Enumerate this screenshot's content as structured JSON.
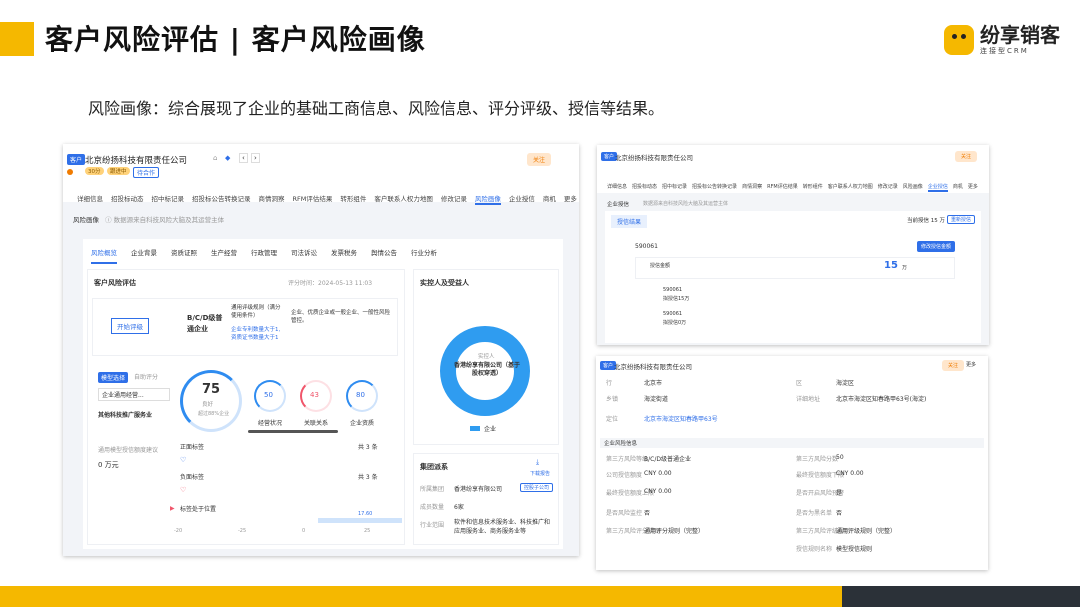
{
  "slide": {
    "title": "客户风险评估 | 客户风险画像",
    "subtitle": "风险画像：综合展现了企业的基础工商信息、风险信息、评分评级、授信等结果。",
    "logo": {
      "name": "纷享销客",
      "tagline": "连接型CRM"
    },
    "colors": {
      "accent": "#f5b800",
      "dark": "#2b3138",
      "brand_blue": "#2f6fe8"
    }
  },
  "main": {
    "header": {
      "tag": "客户",
      "company": "北京纷扬科技有限责任公司",
      "badges": [
        "30分",
        "跟进中"
      ],
      "status": "待合作",
      "follow_button": "关注"
    },
    "nav_tabs": [
      "详细信息",
      "招投标动态",
      "招中标记录",
      "招投标公告转换记录",
      "商情洞察",
      "RFM评估结果",
      "转形组件",
      "客户联系人权力地图",
      "修改记录",
      "风险画像",
      "企业授信",
      "商机",
      "更多"
    ],
    "active_nav": "风险画像",
    "breadcrumb": {
      "title": "风险画像",
      "hint": "数据源来自科技风险大脑及其运营主体"
    },
    "sub_tabs": [
      "风险概览",
      "企业背景",
      "资质证照",
      "生产经营",
      "行政管理",
      "司法诉讼",
      "发票税务",
      "舆情公告",
      "行业分析"
    ],
    "active_sub_tab": "风险概览",
    "risk_eval": {
      "title": "客户风险评估",
      "eval_time": "评分时间：2024-05-13 11:03",
      "start_button": "开始评级",
      "grade": "B/C/D级普通企业",
      "rule_label": "通用评级规则（满分使用条件）",
      "rule_desc": "企业专利数量大于1,资质证书数量大于1",
      "grade_desc": "企业、优质企业或一般企业、一般性风险管控。"
    },
    "model_tabs": [
      "模型选择",
      "自助评分"
    ],
    "model_select": "企业通用经营...",
    "service": "其他科技推广服务业",
    "credit_label": "通用模型授信额度建议",
    "credit_value": "0 万元",
    "score": {
      "value": "75",
      "label": "良好",
      "sub": "超过88%企业"
    },
    "dimensions": [
      {
        "value": "50",
        "label": "经营状况"
      },
      {
        "value": "43",
        "label": "关联关系"
      },
      {
        "value": "80",
        "label": "企业资质"
      }
    ],
    "labels": {
      "positive": "正面标签",
      "positive_count": "共 3 条",
      "negative": "负面标签",
      "negative_count": "共 3 条",
      "position": "标签处于位置",
      "scale": [
        "-20",
        "-25",
        "0",
        "25"
      ],
      "marker": "17.60"
    },
    "shareholder": {
      "title": "实控人及受益人",
      "center_label": "实控人",
      "center_name": "香港纷享有限公司（基于股权穿透）",
      "legend": "企业"
    },
    "group": {
      "title": "集团派系",
      "download": "下载报告",
      "rows": [
        {
          "k": "所属集团",
          "v": "香港纷享有限公司",
          "tag": "控股子公司"
        },
        {
          "k": "成员数量",
          "v": "6家"
        },
        {
          "k": "行业范围",
          "v": "软件和信息技术服务业、科技推广和应用服务业、商务服务业等"
        }
      ]
    }
  },
  "right_top": {
    "company": "北京纷扬科技有限责任公司",
    "nav_tabs": [
      "详细信息",
      "招投标动态",
      "招中标记录",
      "招投标公告转换记录",
      "商情洞察",
      "RFM评估结果",
      "转形组件",
      "客户联系人权力地图",
      "修改记录",
      "风险画像",
      "企业授信",
      "商机",
      "更多"
    ],
    "active_nav": "企业授信",
    "section": "企业授信",
    "hint": "数据源来自科技风险大脑及其运营主体",
    "result_tab": "授信结果",
    "total_label": "当前授信 15 万",
    "refresh_button": "重新授信",
    "id": "590061",
    "modify_button": "修改授信金额",
    "credit": {
      "label": "授信金额",
      "value": "15",
      "unit": "万"
    },
    "history": [
      {
        "id": "590061",
        "desc": "拟授信15万"
      },
      {
        "id": "590061",
        "desc": "拟授信0万"
      }
    ]
  },
  "right_bottom": {
    "company": "北京纷扬科技有限责任公司",
    "follow_button": "关注",
    "more_button": "更多",
    "rows": [
      {
        "k": "行",
        "v": "北京市",
        "k2": "区",
        "v2": "海淀区"
      },
      {
        "k": "乡镇",
        "v": "海淀街道",
        "k2": "详细地址",
        "v2": "北京市海淀区知春路甲63号(海淀)"
      },
      {
        "k": "定位",
        "v": "北京市海淀区知春路甲63号"
      }
    ],
    "section": "企业风险信息",
    "risk_rows": [
      {
        "k": "第三方风险等级",
        "v": "B/C/D级普通企业",
        "k2": "第三方风险分数",
        "v2": "50"
      },
      {
        "k": "公司授信额度",
        "v": "CNY 0.00",
        "k2": "最终授信额度下限",
        "v2": "CNY 0.00"
      },
      {
        "k": "最终授信额度上限",
        "v": "CNY 0.00",
        "k2": "是否开启风险预警",
        "v2": "是"
      },
      {
        "k": "是否风险监控",
        "v": "否",
        "k2": "是否为黑名单",
        "v2": "否"
      },
      {
        "k": "第三方风险评分规则",
        "v": "通用评分规则（完整）",
        "k2": "第三方风险评级规则",
        "v2": "通用评级规则（完整）"
      },
      {
        "k": "授信规则名称",
        "v": "模型授信规则"
      }
    ]
  }
}
